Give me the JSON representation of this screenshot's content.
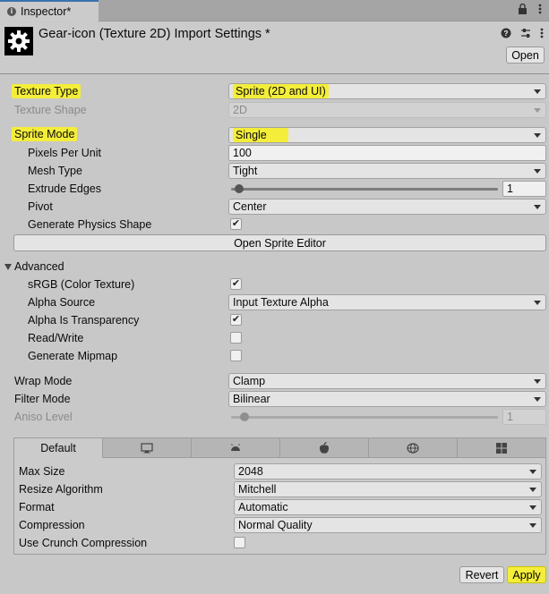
{
  "window": {
    "tab_title": "Inspector*",
    "tab_lock_icon": "lock-icon",
    "tab_menu_icon": "kebab-icon"
  },
  "header": {
    "title": "Gear-icon (Texture 2D) Import Settings *",
    "open_label": "Open",
    "help_icon": "help-icon",
    "settings_icon": "sliders-icon",
    "menu_icon": "kebab-icon"
  },
  "texture": {
    "type_label": "Texture Type",
    "type_value": "Sprite (2D and UI)",
    "shape_label": "Texture Shape",
    "shape_value": "2D"
  },
  "sprite": {
    "mode_label": "Sprite Mode",
    "mode_value": "Single",
    "ppu_label": "Pixels Per Unit",
    "ppu_value": "100",
    "mesh_label": "Mesh Type",
    "mesh_value": "Tight",
    "extrude_label": "Extrude Edges",
    "extrude_value": "1",
    "extrude_fraction": 0.03,
    "pivot_label": "Pivot",
    "pivot_value": "Center",
    "physics_label": "Generate Physics Shape",
    "physics_checked": true,
    "editor_button": "Open Sprite Editor"
  },
  "advanced": {
    "label": "Advanced",
    "srgb_label": "sRGB (Color Texture)",
    "srgb_checked": true,
    "alpha_source_label": "Alpha Source",
    "alpha_source_value": "Input Texture Alpha",
    "alpha_transparency_label": "Alpha Is Transparency",
    "alpha_transparency_checked": true,
    "readwrite_label": "Read/Write",
    "readwrite_checked": false,
    "mipmap_label": "Generate Mipmap",
    "mipmap_checked": false
  },
  "wrap": {
    "wrap_label": "Wrap Mode",
    "wrap_value": "Clamp",
    "filter_label": "Filter Mode",
    "filter_value": "Bilinear",
    "aniso_label": "Aniso Level",
    "aniso_value": "1",
    "aniso_fraction": 0.05
  },
  "platform": {
    "tabs": [
      {
        "label": "Default",
        "icon": ""
      },
      {
        "label": "",
        "icon": "monitor-icon"
      },
      {
        "label": "",
        "icon": "android-icon"
      },
      {
        "label": "",
        "icon": "apple-icon"
      },
      {
        "label": "",
        "icon": "webgl-icon"
      },
      {
        "label": "",
        "icon": "windows-icon"
      }
    ],
    "max_size_label": "Max Size",
    "max_size_value": "2048",
    "resize_label": "Resize Algorithm",
    "resize_value": "Mitchell",
    "format_label": "Format",
    "format_value": "Automatic",
    "compression_label": "Compression",
    "compression_value": "Normal Quality",
    "crunch_label": "Use Crunch Compression",
    "crunch_checked": false
  },
  "footer": {
    "revert_label": "Revert",
    "apply_label": "Apply"
  },
  "colors": {
    "highlight": "#f4ee3a",
    "tab_accent": "#3a72b0"
  }
}
